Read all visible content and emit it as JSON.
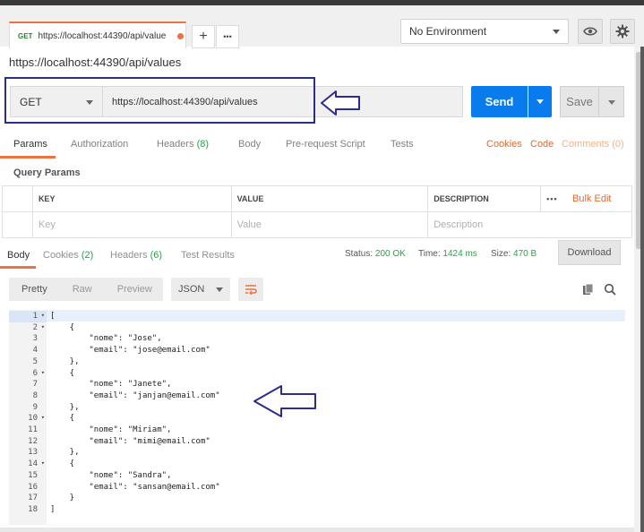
{
  "request_tab": {
    "method": "GET",
    "url": "https://localhost:44390/api/value",
    "add_symbol": "+",
    "more_symbol": "•••"
  },
  "environment": {
    "selected": "No Environment"
  },
  "icons": {
    "eye": "eye-icon",
    "settings": "gear-icon"
  },
  "request_name": "https://localhost:44390/api/values",
  "url_bar": {
    "method": "GET",
    "url": "https://localhost:44390/api/values",
    "send_label": "Send",
    "save_label": "Save"
  },
  "request_tabs": {
    "params": "Params",
    "authorization": "Authorization",
    "headers": "Headers",
    "headers_count": "(8)",
    "body": "Body",
    "pre_request": "Pre-request Script",
    "tests": "Tests",
    "cookies": "Cookies",
    "code": "Code",
    "comments": "Comments (0)"
  },
  "query_params": {
    "title": "Query Params",
    "columns": [
      "KEY",
      "VALUE",
      "DESCRIPTION"
    ],
    "more": "•••",
    "bulk_edit": "Bulk Edit",
    "placeholders": [
      "Key",
      "Value",
      "Description"
    ]
  },
  "response_tabs": {
    "body": "Body",
    "cookies": "Cookies",
    "cookies_count": "(2)",
    "headers": "Headers",
    "headers_count": "(6)",
    "test_results": "Test Results"
  },
  "response_meta": {
    "status_label": "Status:",
    "status_value": "200 OK",
    "time_label": "Time:",
    "time_value": "1424 ms",
    "size_label": "Size:",
    "size_value": "470 B",
    "download_label": "Download"
  },
  "format_bar": {
    "options": [
      "Pretty",
      "Raw",
      "Preview"
    ],
    "active": "Pretty",
    "language": "JSON"
  },
  "response_body": {
    "line_numbers": [
      "1",
      "2",
      "3",
      "4",
      "5",
      "6",
      "7",
      "8",
      "9",
      "10",
      "11",
      "12",
      "13",
      "14",
      "15",
      "16",
      "17",
      "18"
    ],
    "lines": [
      "[",
      "    {",
      "        \"nome\": \"Jose\",",
      "        \"email\": \"jose@email.com\"",
      "    },",
      "    {",
      "        \"nome\": \"Janete\",",
      "        \"email\": \"janjan@email.com\"",
      "    },",
      "    {",
      "        \"nome\": \"Miriam\",",
      "        \"email\": \"mimi@email.com\"",
      "    },",
      "    {",
      "        \"nome\": \"Sandra\",",
      "        \"email\": \"sansan@email.com\"",
      "    }",
      "]"
    ],
    "fold_lines": [
      1,
      2,
      6,
      10,
      14
    ]
  },
  "colors": {
    "accent": "#ef7042",
    "send_blue": "#097bed",
    "status_green": "#26a347",
    "annotation_navy": "#2b2d8c"
  }
}
